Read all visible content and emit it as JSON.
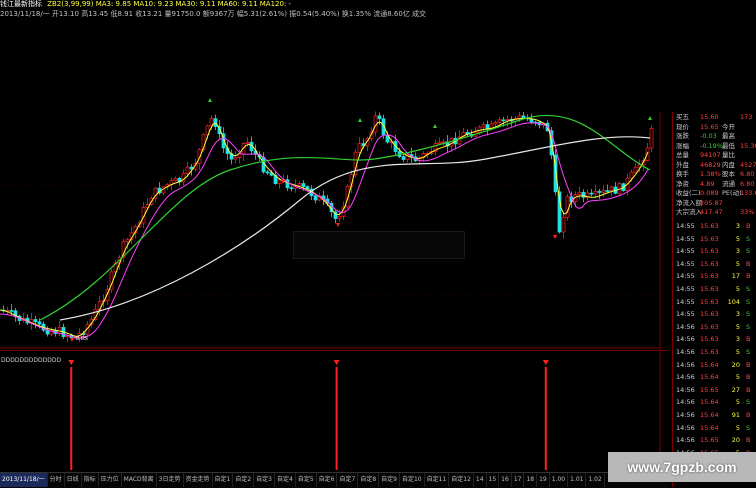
{
  "top_bar": {
    "line1": "钱江最新指标",
    "line1b": "ZB2(3,99,99)  MA3: 9.85  MA10: 9.23  MA30: 9.11  MA60: 9.11  MA120: -",
    "line2": "2013/11/18/一  开13.10  高13.45  低8.91  收13.21  量91750.0  额9367万  幅5.31(2.61%)  振0.54(5.40%)  换1.35%  流通8.60亿  成交"
  },
  "main_chart": {
    "low_label": "8.65",
    "signal_text": "DDDDDDDDDDDDD",
    "colors": {
      "price": "#ffffff",
      "ma5": "#ffff40",
      "ma10": "#ff40ff",
      "ma30": "#30d030",
      "ma60": "#e8e8e8",
      "up": "#ff2020",
      "down": "#20e0e0"
    }
  },
  "sub_chart": {
    "signal_label": "DDDDDDDDDDDDD",
    "signal_positions": [
      0.108,
      0.51,
      0.827
    ]
  },
  "bottom_tabs": [
    "2013/11/18/一"
  ],
  "bottom_tab_labels": [
    "分时",
    "日线",
    "指标",
    "压力位",
    "MACD背离",
    "3日走势",
    "资金走势",
    "自定1",
    "自定2",
    "自定3",
    "自定4",
    "自定5",
    "自定6",
    "自定7",
    "自定8",
    "自定9",
    "自定10",
    "自定11",
    "自定12",
    "14",
    "15",
    "16",
    "17",
    "18",
    "19",
    "1.00",
    "1.01",
    "1.02"
  ],
  "quote_panel": {
    "rows": [
      {
        "l": "买五",
        "v": "15.60",
        "r": "",
        "rv": "173"
      },
      {
        "l": "现价",
        "v": "15.65",
        "r": "今开",
        "rv": ""
      },
      {
        "l": "涨跌",
        "v": "-0.03",
        "r": "最高",
        "rv": ""
      },
      {
        "l": "涨幅",
        "v": "-0.19%",
        "r": "最低",
        "rv": "15.30"
      },
      {
        "l": "总量",
        "v": "94107",
        "r": "量比",
        "rv": ""
      },
      {
        "l": "外盘",
        "v": "46829",
        "r": "内盘",
        "rv": "45278"
      },
      {
        "l": "换手",
        "v": "1.38%",
        "r": "股本",
        "rv": "6.80"
      },
      {
        "l": "净资",
        "v": "4.89",
        "r": "流通",
        "rv": "6.80"
      },
      {
        "l": "收益(二)",
        "v": "0.089",
        "r": "PE(动)",
        "rv": "133.6"
      },
      {
        "l": "净流入额",
        "v": "205.87",
        "r": "",
        "rv": ""
      },
      {
        "l": "大宗流入",
        "v": "417.47",
        "r": "",
        "rv": "33%"
      }
    ],
    "ticks": [
      {
        "t": "14:55",
        "p": "15.63",
        "v": "3",
        "s": "B"
      },
      {
        "t": "14:55",
        "p": "15.63",
        "v": "5",
        "s": "S"
      },
      {
        "t": "14:55",
        "p": "15.63",
        "v": "3",
        "s": "S"
      },
      {
        "t": "14:55",
        "p": "15.63",
        "v": "5",
        "s": "B"
      },
      {
        "t": "14:55",
        "p": "15.63",
        "v": "17",
        "s": "B"
      },
      {
        "t": "14:55",
        "p": "15.63",
        "v": "5",
        "s": "S"
      },
      {
        "t": "14:55",
        "p": "15.63",
        "v": "104",
        "s": "S"
      },
      {
        "t": "14:55",
        "p": "15.63",
        "v": "3",
        "s": "S"
      },
      {
        "t": "14:56",
        "p": "15.63",
        "v": "5",
        "s": "S"
      },
      {
        "t": "14:56",
        "p": "15.63",
        "v": "3",
        "s": "B"
      },
      {
        "t": "14:56",
        "p": "15.63",
        "v": "5",
        "s": "S"
      },
      {
        "t": "14:56",
        "p": "15.64",
        "v": "20",
        "s": "B"
      },
      {
        "t": "14:56",
        "p": "15.64",
        "v": "5",
        "s": "B"
      },
      {
        "t": "14:56",
        "p": "15.65",
        "v": "27",
        "s": "B"
      },
      {
        "t": "14:56",
        "p": "15.64",
        "v": "5",
        "s": "S"
      },
      {
        "t": "14:56",
        "p": "15.64",
        "v": "91",
        "s": "B"
      },
      {
        "t": "14:56",
        "p": "15.64",
        "v": "5",
        "s": "S"
      },
      {
        "t": "14:56",
        "p": "15.65",
        "v": "20",
        "s": "B"
      },
      {
        "t": "14:56",
        "p": "15.65",
        "v": "5",
        "s": "B"
      },
      {
        "t": "14:56",
        "p": "15.65",
        "v": "5",
        "s": "S"
      }
    ]
  },
  "watermark": "www.7gpzb.com"
}
